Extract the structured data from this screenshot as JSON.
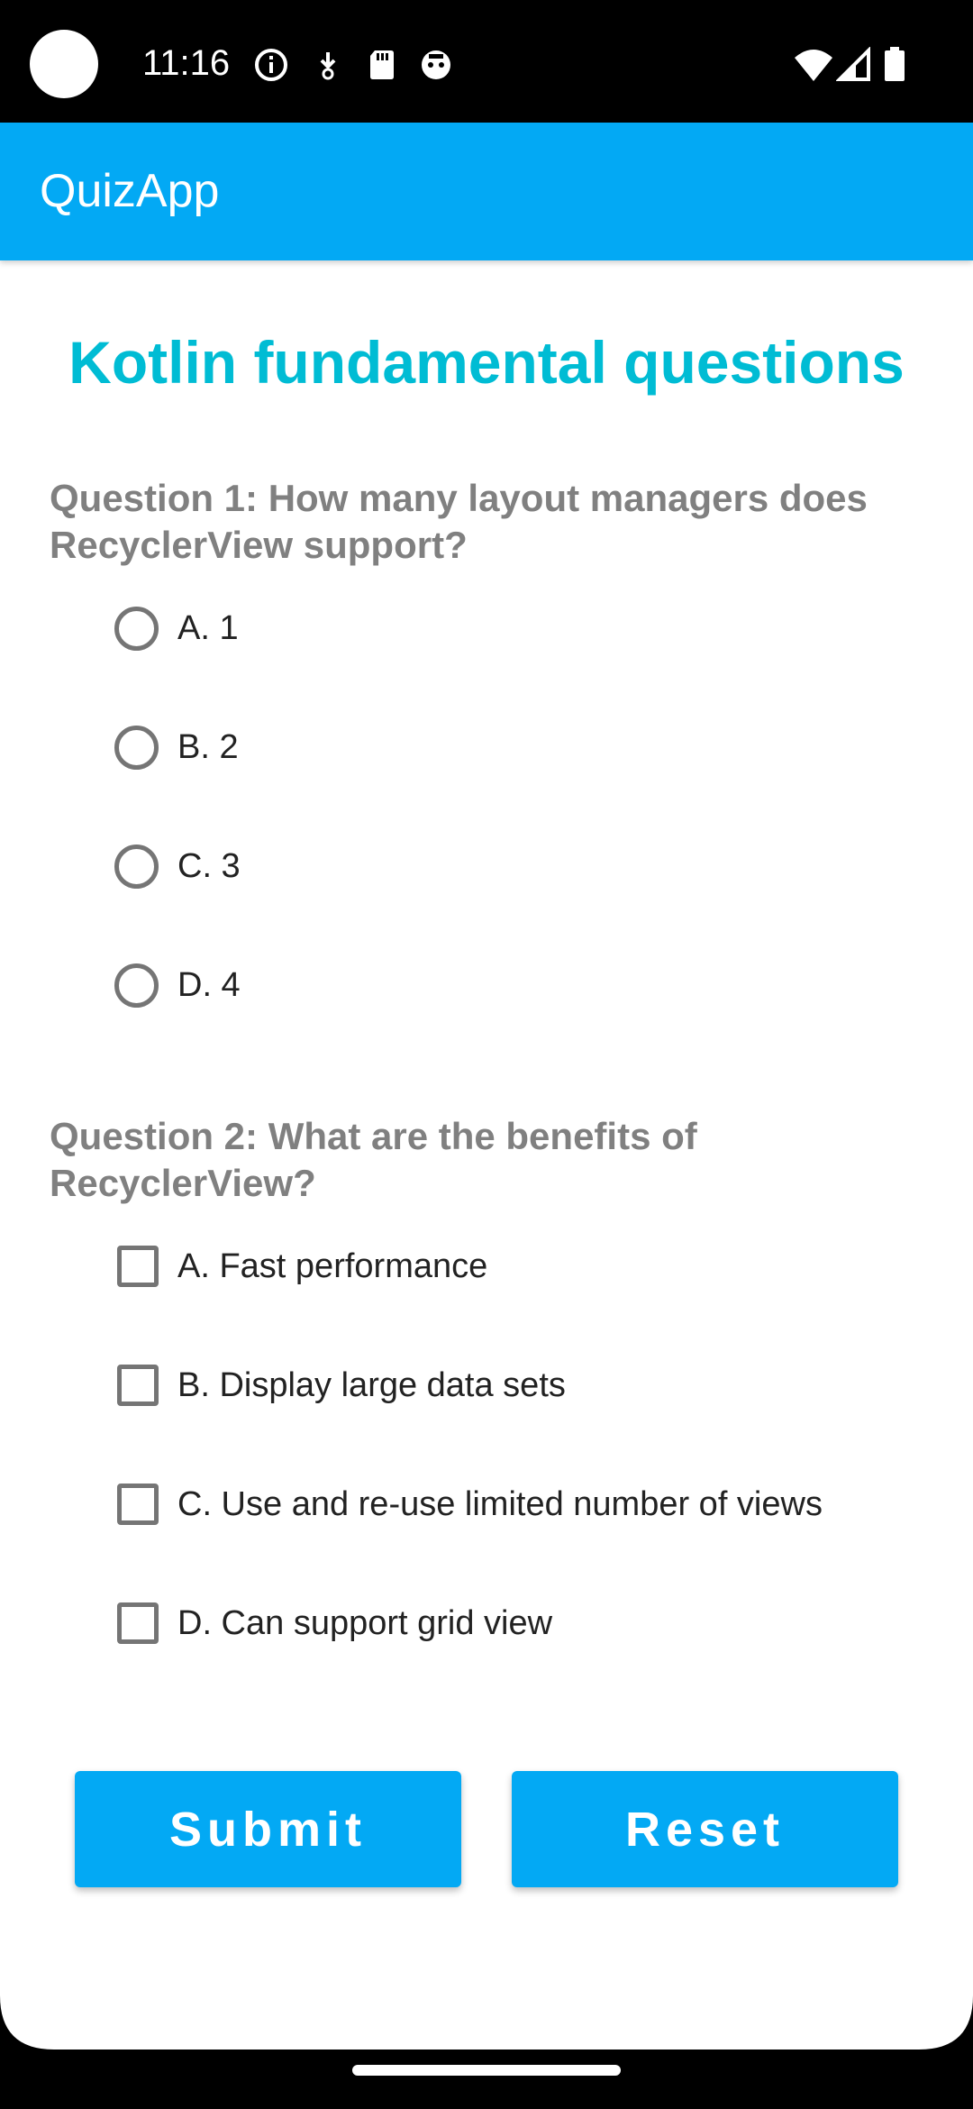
{
  "status_bar": {
    "time": "11:16",
    "left_icons": [
      "info-icon",
      "download-icon",
      "sd-card-icon",
      "robot-face-icon"
    ],
    "right_icons": [
      "wifi-icon",
      "signal-icon",
      "battery-icon"
    ]
  },
  "app_bar": {
    "title": "QuizApp"
  },
  "heading": "Kotlin fundamental questions",
  "question1": {
    "text": "Question 1: How many layout managers does RecyclerView support?",
    "options": [
      {
        "label": "A. 1",
        "selected": false
      },
      {
        "label": "B. 2",
        "selected": false
      },
      {
        "label": "C. 3",
        "selected": false
      },
      {
        "label": "D. 4",
        "selected": false
      }
    ]
  },
  "question2": {
    "text": "Question 2: What are the benefits of RecyclerView?",
    "options": [
      {
        "label": "A. Fast performance",
        "checked": false
      },
      {
        "label": "B. Display large data sets",
        "checked": false
      },
      {
        "label": "C. Use and re-use limited number of views",
        "checked": false
      },
      {
        "label": "D. Can support grid view",
        "checked": false
      }
    ]
  },
  "buttons": {
    "submit": "Submit",
    "reset": "Reset"
  },
  "colors": {
    "accent": "#03a9f4",
    "heading": "#00bcd4",
    "question_text": "#808080"
  }
}
